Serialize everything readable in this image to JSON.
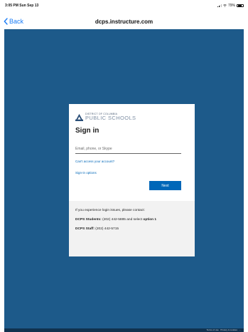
{
  "status_bar": {
    "time": "3:05 PM",
    "date": "Sun Sep 13",
    "battery": "79%",
    "battery_level": 0.79
  },
  "nav": {
    "back_label": "Back",
    "url": "dcps.instructure.com"
  },
  "brand": {
    "line1": "DISTRICT OF COLUMBIA",
    "line2": "PUBLIC SCHOOLS"
  },
  "signin": {
    "heading": "Sign in",
    "email_placeholder": "Email, phone, or Skype",
    "email_value": "",
    "cant_access_link": "Can't access your account?",
    "options_link": "Sign-in options",
    "next_label": "Next"
  },
  "help": {
    "intro": "If you experience login issues, please contact:",
    "students_label": "DCPS Students:",
    "students_text": " (202) 442-5885 and select ",
    "students_option": "option 1",
    "staff_label": "DCPS Staff:",
    "staff_text": " (202) 442-5715"
  },
  "footer": {
    "terms": "Terms of use",
    "privacy": "Privacy & cookies",
    "more": "..."
  },
  "colors": {
    "page_background": "#1d5a8a",
    "link": "#0067b8",
    "next_button": "#0067b8",
    "nav_accent": "#1a7cf6"
  }
}
